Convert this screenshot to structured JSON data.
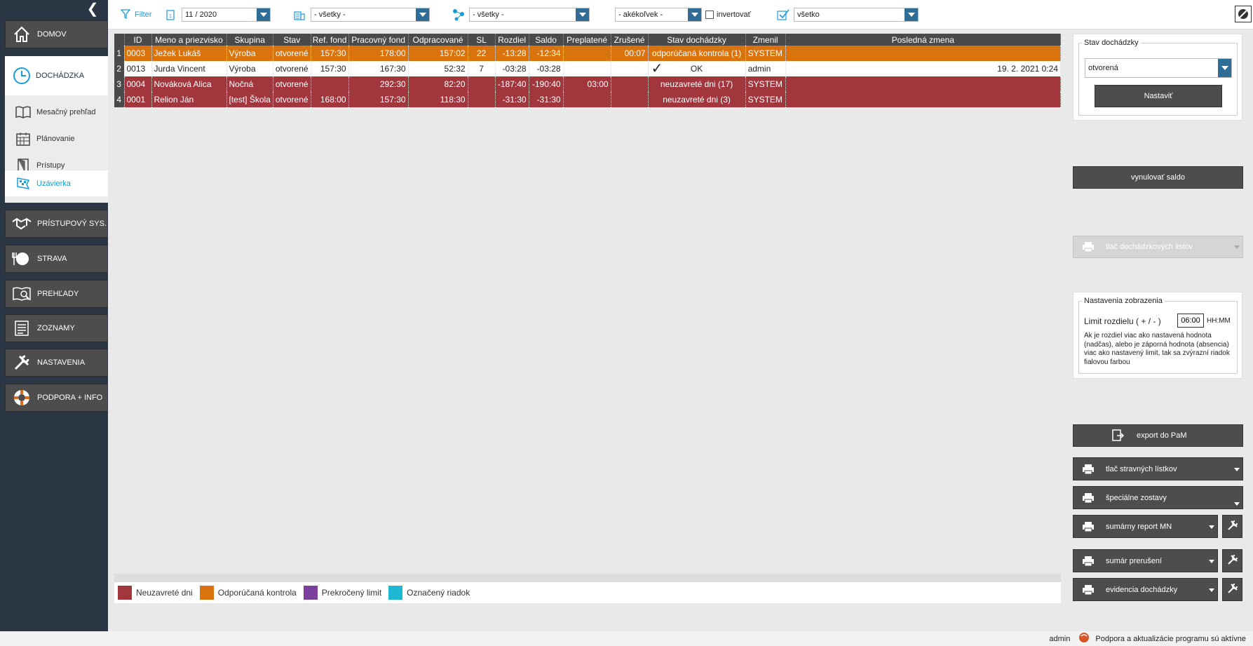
{
  "sidebar": {
    "nav": [
      {
        "label": "DOMOV",
        "icon": "home-icon"
      },
      {
        "label": "PRÍSTUPOVÝ SYS.",
        "icon": "handshake-icon"
      },
      {
        "label": "STRAVA",
        "icon": "plate-icon"
      },
      {
        "label": "PREHĽADY",
        "icon": "book-search-icon"
      },
      {
        "label": "ZOZNAMY",
        "icon": "list-icon"
      },
      {
        "label": "NASTAVENIA",
        "icon": "tools-icon"
      },
      {
        "label": "PODPORA + INFO",
        "icon": "lifebuoy-icon"
      }
    ],
    "section": {
      "label": "DOCHÁDZKA",
      "icon": "clock-icon"
    },
    "subitems": [
      {
        "label": "Mesačný prehľad",
        "icon": "open-book-icon"
      },
      {
        "label": "Plánovanie",
        "icon": "calendar-icon"
      },
      {
        "label": "Prístupy",
        "icon": "door-icon"
      },
      {
        "label": "Uzávierka",
        "icon": "checkered-flag-icon",
        "active": true
      }
    ]
  },
  "toolbar": {
    "filter_label": "Filter",
    "period": "11 / 2020",
    "building": "- všetky -",
    "group": "- všetky -",
    "any": "- akékoľvek -",
    "invert_label": "invertovať",
    "state": "všetko"
  },
  "table": {
    "headers": [
      "ID",
      "Meno a priezvisko",
      "Skupina",
      "Stav",
      "Ref. fond",
      "Pracovný fond",
      "Odpracované",
      "SL",
      "Rozdiel",
      "Saldo",
      "Preplatené",
      "Zrušené",
      "Stav dochádzky",
      "Zmenil",
      "Posledná zmena"
    ],
    "rows": [
      {
        "n": "1",
        "style": "orange",
        "cells": [
          "0003",
          "Ježek Lukáš",
          "Výroba",
          "otvorené",
          "157:30",
          "178:00",
          "157:02",
          "22",
          "-13:28",
          "-12:34",
          "",
          "00:07",
          "odporúčaná kontrola (1)",
          "SYSTEM",
          ""
        ]
      },
      {
        "n": "2",
        "style": "white",
        "check": true,
        "cells": [
          "0013",
          "Jurda Vincent",
          "Výroba",
          "otvorené",
          "157:30",
          "167:30",
          "52:32",
          "7",
          "-03:28",
          "-03:28",
          "",
          "",
          "OK",
          "admin",
          "19. 2. 2021 0:24"
        ]
      },
      {
        "n": "3",
        "style": "red",
        "cells": [
          "0004",
          "Nováková Alica",
          "Nočná",
          "otvorené",
          "",
          "292:30",
          "82:20",
          "",
          "-187:40",
          "-190:40",
          "03:00",
          "",
          "neuzavreté dni (17)",
          "SYSTEM",
          ""
        ]
      },
      {
        "n": "4",
        "style": "red",
        "cells": [
          "0001",
          "Relion Ján",
          "[test] Škola",
          "otvorené",
          "168:00",
          "157:30",
          "118:30",
          "",
          "-31:30",
          "-31:30",
          "",
          "",
          "neuzavreté dni (3)",
          "SYSTEM",
          ""
        ]
      }
    ]
  },
  "legend": [
    {
      "label": "Neuzavreté dni",
      "color": "#a1373d"
    },
    {
      "label": "Odporúčaná kontrola",
      "color": "#d9730d"
    },
    {
      "label": "Prekročený limit",
      "color": "#7b3f9e"
    },
    {
      "label": "Označený riadok",
      "color": "#1fb7d4"
    }
  ],
  "right": {
    "stav_legend": "Stav dochádzky",
    "stav_value": "otvorená",
    "nastavit": "Nastaviť",
    "vynulovat": "vynulovať saldo",
    "tlac_listov": "tlač dochádzkových listov",
    "nast_legend": "Nastavenia zobrazenia",
    "limit_label": "Limit rozdielu ( + / - )",
    "limit_value": "06:00",
    "limit_unit": "HH:MM",
    "limit_desc": "Ak je rozdiel viac ako nastavená hodnota (nadčas), alebo je záporná hodnota (absencia) viac ako nastavený limit, tak sa zvýrazní riadok fialovou farbou",
    "export": "export do PaM",
    "tlac_strav": "tlač stravných lístkov",
    "specialne": "špeciálne zostavy",
    "sumarny": "sumárny report MN",
    "sumar_prer": "sumár prerušení",
    "evidencia": "evidencia dochádzky"
  },
  "status": {
    "user": "admin",
    "message": "Podpora a aktualizácie programu sú aktívne"
  }
}
